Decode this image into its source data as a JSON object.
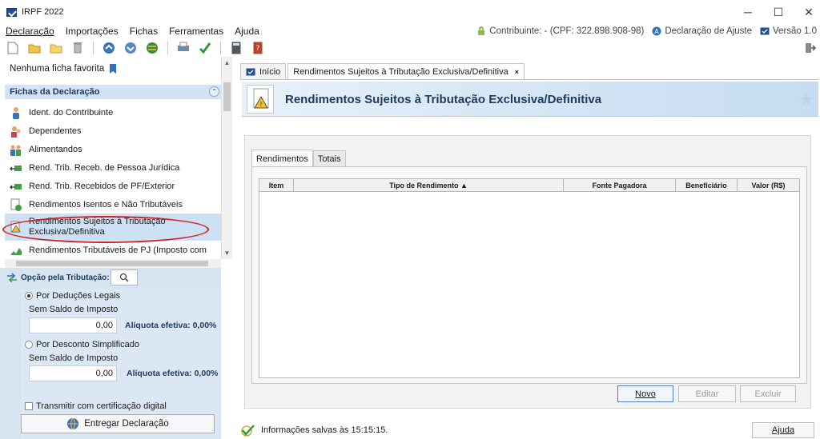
{
  "window": {
    "title": "IRPF 2022"
  },
  "menu": {
    "items": [
      "Declaração",
      "Importações",
      "Fichas",
      "Ferramentas",
      "Ajuda"
    ],
    "contribuinte": "Contribuinte: - (CPF: 322.898.908-98)",
    "declaracao": "Declaração de Ajuste",
    "versao": "Versão 1.0"
  },
  "left": {
    "favorites_label": "Nenhuma ficha favorita",
    "fichas_title": "Fichas da Declaração",
    "fichas": [
      "Ident. do Contribuinte",
      "Dependentes",
      "Alimentandos",
      "Rend. Trib. Receb. de Pessoa Jurídica",
      "Rend. Trib. Recebidos de PF/Exterior",
      "Rendimentos Isentos e Não Tributáveis",
      "Rendimentos Sujeitos à Tributação Exclusiva/Definitiva",
      "Rendimentos Tributáveis de PJ (Imposto com"
    ],
    "selected_ficha_line1": "Rendimentos Sujeitos à Tributação",
    "selected_ficha_line2": "Exclusiva/Definitiva",
    "opcao_label": "Opção pela Tributação:",
    "deducoes_label": "Por Deduções Legais",
    "deducoes_sub": "Sem Saldo de Imposto",
    "deducoes_value": "0,00",
    "deducoes_aliquota": "Alíquota efetiva: 0,00%",
    "simplificado_label": "Por Desconto Simplificado",
    "simplificado_sub": "Sem Saldo de Imposto",
    "simplificado_value": "0,00",
    "simplificado_aliquota": "Alíquota efetiva: 0,00%",
    "certificado_label": "Transmitir com certificação digital",
    "entregar_label": "Entregar Declaração"
  },
  "main": {
    "tabs": [
      "Início",
      "Rendimentos Sujeitos à Tributação Exclusiva/Definitiva"
    ],
    "heading": "Rendimentos Sujeitos à Tributação Exclusiva/Definitiva",
    "inner_tabs": [
      "Rendimentos",
      "Totais"
    ],
    "columns": [
      "Item",
      "Tipo de Rendimento ▲",
      "Fonte Pagadora",
      "Beneficiário",
      "Valor (R$)"
    ],
    "buttons": {
      "novo": "Novo",
      "editar": "Editar",
      "excluir": "Excluir"
    }
  },
  "status": {
    "message": "Informações salvas às 15:15:15.",
    "ajuda": "Ajuda"
  },
  "colors": {
    "accent": "#1f3a5f",
    "panel_bg": "#d6e4f2",
    "highlight": "#d42020"
  }
}
